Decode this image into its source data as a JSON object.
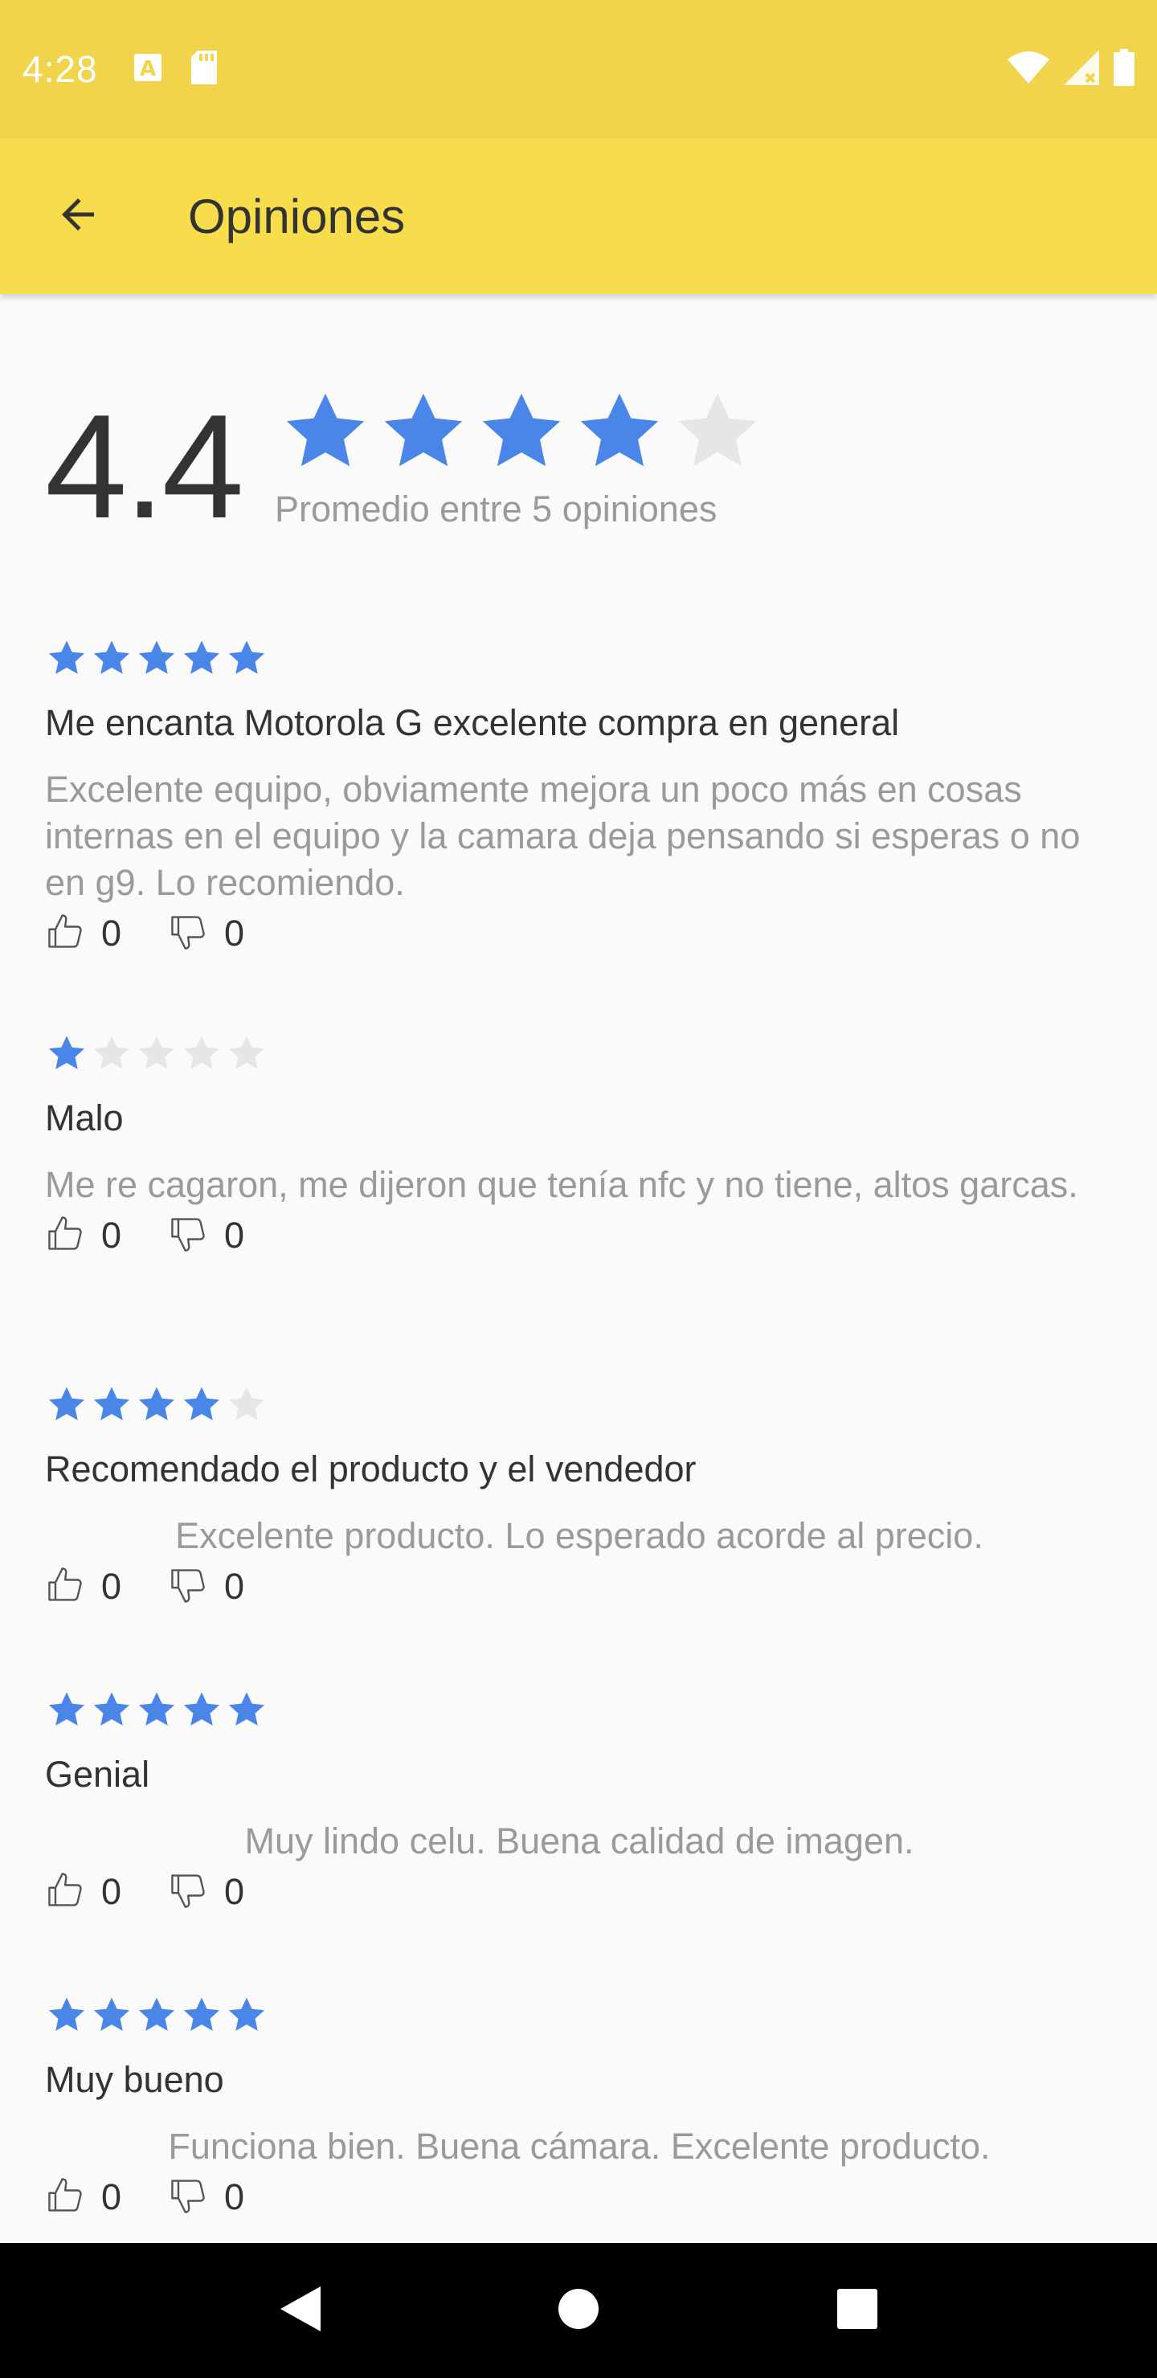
{
  "status_bar": {
    "time": "4:28",
    "icons": [
      "font-icon",
      "sd-card-icon",
      "wifi-icon",
      "signal-icon",
      "battery-icon"
    ]
  },
  "app_bar": {
    "title": "Opiniones",
    "back_icon": "arrow-back-icon"
  },
  "summary": {
    "average": "4.4",
    "average_rating": 4,
    "caption": "Promedio entre 5 opiniones"
  },
  "reviews": [
    {
      "rating": 5,
      "title": "Me encanta Motorola G excelente compra en general",
      "body": "Excelente equipo, obviamente mejora un poco más en cosas internas en el equipo y la camara deja pensando si esperas o no en g9. Lo recomiendo.",
      "likes": "0",
      "dislikes": "0"
    },
    {
      "rating": 1,
      "title": "Malo",
      "body": "Me re cagaron, me dijeron que tenía nfc y no tiene, altos garcas.",
      "likes": "0",
      "dislikes": "0"
    },
    {
      "rating": 4,
      "title": "Recomendado el producto y el vendedor",
      "body": "Excelente producto. Lo esperado acorde al precio.",
      "likes": "0",
      "dislikes": "0"
    },
    {
      "rating": 5,
      "title": "Genial",
      "body": "Muy lindo celu. Buena calidad de imagen.",
      "likes": "0",
      "dislikes": "0"
    },
    {
      "rating": 5,
      "title": "Muy bueno",
      "body": "Funciona bien. Buena cámara. Excelente producto.",
      "likes": "0",
      "dislikes": "0"
    }
  ],
  "colors": {
    "status_bar": "#f1d44b",
    "app_bar": "#f7dc4b",
    "star_filled": "#4a86e8",
    "star_empty": "#e6e6e6",
    "text_primary": "#333333",
    "text_secondary": "#9a9a9a"
  },
  "nav_bar": {
    "icons": [
      "nav-back-icon",
      "nav-home-icon",
      "nav-recents-icon"
    ]
  }
}
